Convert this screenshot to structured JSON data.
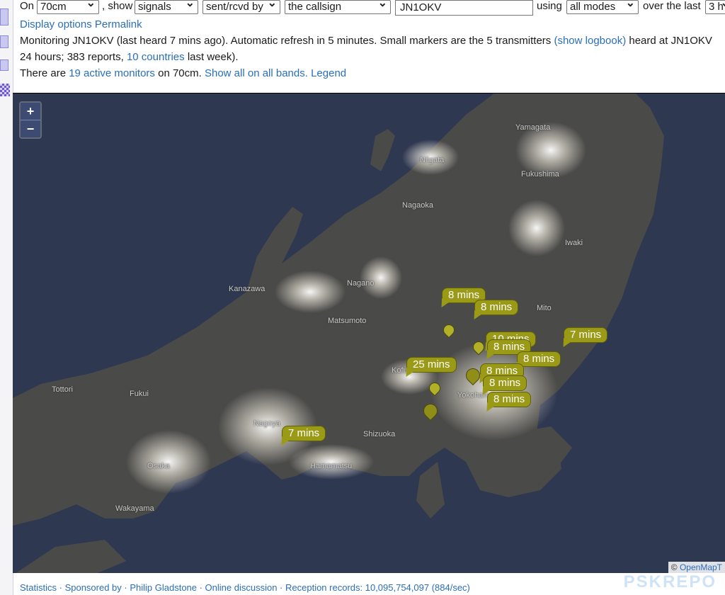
{
  "controls": {
    "on_label": "On",
    "band": "70cm",
    "show_label": ", show",
    "signals": "signals",
    "direction": "sent/rcvd by",
    "callsign_mode": "the callsign",
    "callsign": "JN1OKV",
    "using_label": "using",
    "modes": "all modes",
    "over_label": "over the last",
    "period": "3 h"
  },
  "links": {
    "display_options": "Display options",
    "permalink": "Permalink"
  },
  "status": {
    "monitoring_prefix": "Monitoring JN1OKV (last heard 7 mins ago). Automatic refresh in 5 minutes. Small markers are the 5 transmitters ",
    "show_logbook": "(show logbook)",
    "monitoring_suffix": " heard at JN1OKV",
    "reports_prefix": "24 hours; 383 reports, ",
    "countries_link": "10 countries",
    "reports_suffix": " last week).",
    "active_prefix": "There are ",
    "active_link": "19 active monitors",
    "active_mid": " on 70cm. ",
    "show_all": "Show all on all bands.",
    "legend": "Legend"
  },
  "map": {
    "zoom_in": "+",
    "zoom_out": "−",
    "attribution_symbol": "©",
    "attribution_link": "OpenMapT",
    "labels": [
      "Yamagata",
      "Niigata",
      "Fukushima",
      "Nagaoka",
      "Iwaki",
      "Kanazawa",
      "Nagano",
      "Matsumoto",
      "Mito",
      "Tottori",
      "Fukui",
      "Nagoya",
      "Shizuoka",
      "Osaka",
      "Wakayama",
      "Hamamatsu",
      "Kofu",
      "Yokohama"
    ],
    "bubbles": [
      "8 mins",
      "8 mins",
      "7 mins",
      "10 mins",
      "8 mins",
      "8 mins",
      "25 mins",
      "8 mins",
      "8 mins",
      "8 mins",
      "7 mins"
    ]
  },
  "footer": {
    "text": "Statistics  ·  Sponsored by  ·  Philip Gladstone  ·  Online discussion  ·  Reception records: 10,095,754,097 (884/sec)"
  },
  "watermark": "PSKREPO"
}
